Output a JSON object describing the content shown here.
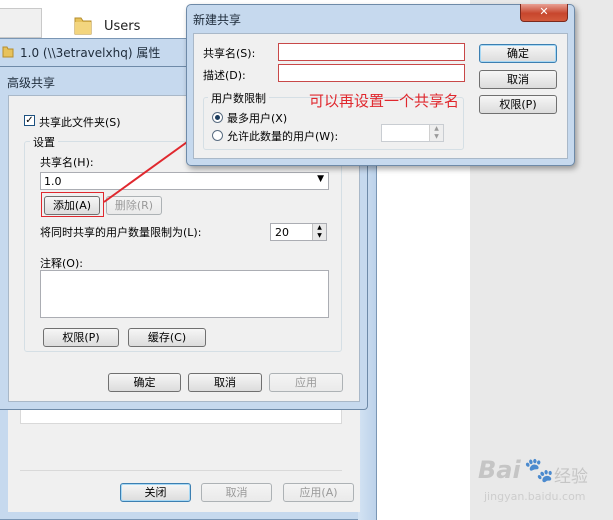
{
  "background": {
    "folder_label": "Users"
  },
  "props_window": {
    "title": "1.0 (\\\\3etravelxhq) 属性",
    "buttons": {
      "close": "关闭",
      "cancel": "取消",
      "apply": "应用(A)"
    }
  },
  "advanced_share": {
    "title": "高级共享",
    "share_checkbox": "共享此文件夹(S)",
    "settings_group": "设置",
    "share_name_label": "共享名(H):",
    "share_name_value": "1.0",
    "add_button": "添加(A)",
    "remove_button": "删除(R)",
    "limit_label": "将同时共享的用户数量限制为(L):",
    "limit_value": "20",
    "comment_label": "注释(O):",
    "permissions_button": "权限(P)",
    "cache_button": "缓存(C)",
    "ok": "确定",
    "cancel": "取消",
    "apply": "应用"
  },
  "new_share": {
    "title": "新建共享",
    "share_name_label": "共享名(S):",
    "description_label": "描述(D):",
    "user_limit_group": "用户数限制",
    "max_users": "最多用户(X)",
    "allow_users": "允许此数量的用户(W):",
    "ok": "确定",
    "cancel": "取消",
    "permissions": "权限(P)"
  },
  "annotation": {
    "text": "可以再设置一个共享名",
    "color": "#e0282e"
  },
  "watermark": {
    "brand": "Bai",
    "sub": "经验",
    "url": "jingyan.baidu.com"
  },
  "colors": {
    "window_frame": "#c6d9ee",
    "dialog_bg": "#f0f0f0",
    "accent": "#e0282e"
  }
}
